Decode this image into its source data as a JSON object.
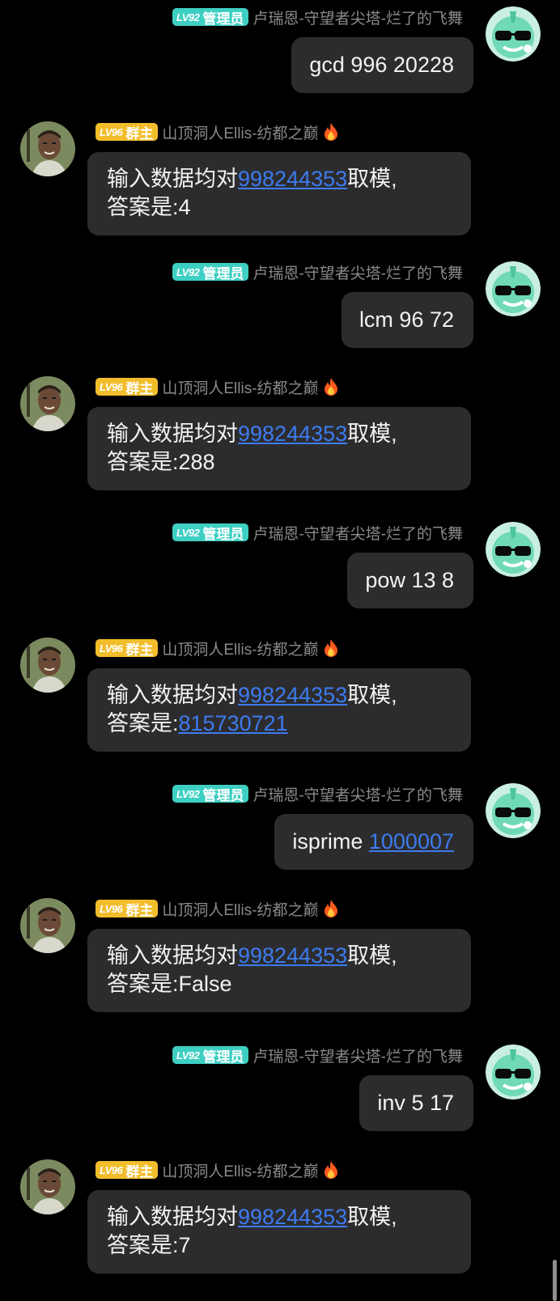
{
  "admin_user": {
    "level": "LV92",
    "role": "管理员",
    "name": "卢瑞恩-守望者尖塔-烂了的飞舞",
    "avatar": "cool-sunglasses-cat-avatar"
  },
  "bot_user": {
    "level": "LV96",
    "role": "群主",
    "name": "山顶洞人Ellis-纺都之巅",
    "name_icon": "fire-icon",
    "avatar": "man-portrait-avatar"
  },
  "colors": {
    "background": "#000000",
    "bubble": "#2c2c2e",
    "admin_badge": "#3ecfc3",
    "owner_badge": "#f2bd2b",
    "link": "#3d7bf0",
    "name_text": "#8a8a8a"
  },
  "reply_prefix": "输入数据均对",
  "reply_modulus": "998244353",
  "reply_suffix": "取模,",
  "answer_prefix": "答案是:",
  "messages": [
    {
      "cmd": "gcd 996 20228",
      "answer": "4"
    },
    {
      "cmd": "lcm 96 72",
      "answer": "288"
    },
    {
      "cmd": "pow 13 8",
      "answer": "815730721"
    },
    {
      "cmd_word": "isprime ",
      "cmd_number": "1000007",
      "answer": "False"
    },
    {
      "cmd": "inv 5 17",
      "answer": "7"
    }
  ]
}
